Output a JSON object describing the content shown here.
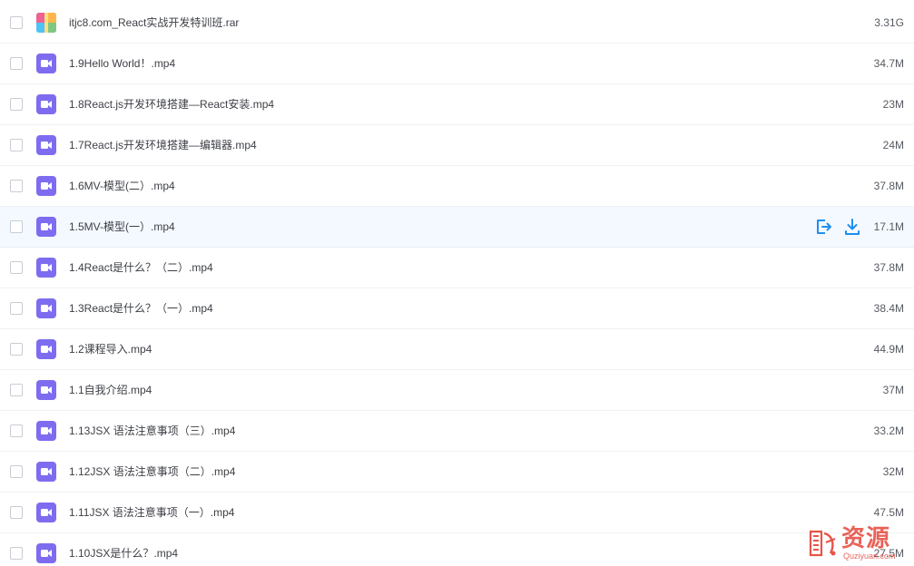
{
  "files": [
    {
      "name": "itjc8.com_React实战开发特训班.rar",
      "size": "3.31G",
      "type": "archive",
      "icon": "archive-icon"
    },
    {
      "name": "1.9Hello World！.mp4",
      "size": "34.7M",
      "type": "video",
      "icon": "video-file-icon"
    },
    {
      "name": "1.8React.js开发环境搭建—React安装.mp4",
      "size": "23M",
      "type": "video",
      "icon": "video-file-icon"
    },
    {
      "name": "1.7React.js开发环境搭建—编辑器.mp4",
      "size": "24M",
      "type": "video",
      "icon": "video-file-icon"
    },
    {
      "name": "1.6MV-模型(二）.mp4",
      "size": "37.8M",
      "type": "video",
      "icon": "video-file-icon"
    },
    {
      "name": "1.5MV-模型(一）.mp4",
      "size": "17.1M",
      "type": "video",
      "icon": "video-file-icon",
      "hovered": true
    },
    {
      "name": "1.4React是什么？（二）.mp4",
      "size": "37.8M",
      "type": "video",
      "icon": "video-file-icon"
    },
    {
      "name": "1.3React是什么？（一）.mp4",
      "size": "38.4M",
      "type": "video",
      "icon": "video-file-icon"
    },
    {
      "name": "1.2课程导入.mp4",
      "size": "44.9M",
      "type": "video",
      "icon": "video-file-icon"
    },
    {
      "name": "1.1自我介绍.mp4",
      "size": "37M",
      "type": "video",
      "icon": "video-file-icon"
    },
    {
      "name": "1.13JSX 语法注意事项（三）.mp4",
      "size": "33.2M",
      "type": "video",
      "icon": "video-file-icon"
    },
    {
      "name": "1.12JSX 语法注意事项（二）.mp4",
      "size": "32M",
      "type": "video",
      "icon": "video-file-icon"
    },
    {
      "name": "1.11JSX 语法注意事项（一）.mp4",
      "size": "47.5M",
      "type": "video",
      "icon": "video-file-icon"
    },
    {
      "name": "1.10JSX是什么？.mp4",
      "size": "27.5M",
      "type": "video",
      "icon": "video-file-icon"
    }
  ],
  "row_actions": {
    "share_icon": "share-icon",
    "download_icon": "download-icon"
  },
  "watermark": {
    "text": "资源",
    "sub": "Quziyuan.com",
    "icon": "watermark-logo-icon"
  },
  "colors": {
    "accent": "#1f8ff0",
    "video_icon": "#7e6cf0",
    "hover_row": "#f4f9ff",
    "watermark": "#e8554a"
  }
}
